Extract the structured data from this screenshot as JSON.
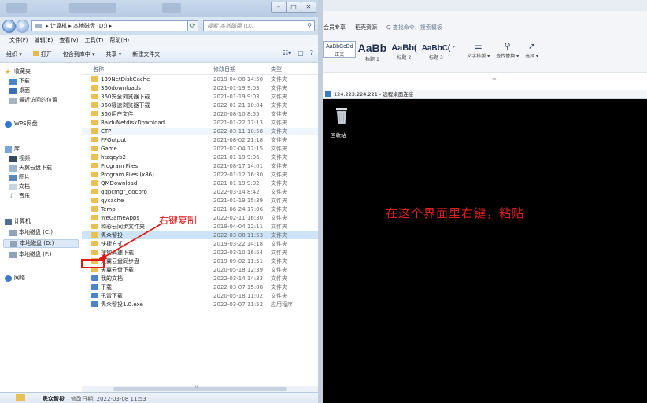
{
  "explorer": {
    "window_buttons": [
      "–",
      "□",
      "✕"
    ],
    "address": {
      "crumbs": [
        "计算机",
        "本地磁盘 (D:)"
      ],
      "separator": "▸",
      "search_placeholder": "搜索 本地磁盘 (D:)"
    },
    "menu": [
      "文件(F)",
      "编辑(E)",
      "查看(V)",
      "工具(T)",
      "帮助(H)"
    ],
    "toolbar": [
      "组织 ▾",
      "打开",
      "包含到库中 ▾",
      "共享 ▾",
      "新建文件夹"
    ],
    "nav": {
      "favorites": "收藏夹",
      "fav_items": [
        "下载",
        "桌面",
        "最近访问的位置"
      ],
      "wps": "WPS网盘",
      "library": "库",
      "lib_items": [
        "视频",
        "天翼云盘下载",
        "图片",
        "文档",
        "音乐"
      ],
      "computer": "计算机",
      "drives": [
        "本地磁盘 (C:)",
        "本地磁盘 (D:)",
        "本地磁盘 (F:)"
      ],
      "network": "网络"
    },
    "columns": [
      "名称",
      "修改日期",
      "类型"
    ],
    "files": [
      {
        "name": "139NetDiskCache",
        "date": "2019-04-08 14:50",
        "type": "文件夹"
      },
      {
        "name": "360downloads",
        "date": "2021-01-19 9:03",
        "type": "文件夹"
      },
      {
        "name": "360安全浏览器下载",
        "date": "2021-01-19 9:03",
        "type": "文件夹"
      },
      {
        "name": "360极速浏览器下载",
        "date": "2022-01-21 10:04",
        "type": "文件夹"
      },
      {
        "name": "360用户文件",
        "date": "2020-08-10 8:55",
        "type": "文件夹"
      },
      {
        "name": "BaiduNetdiskDownload",
        "date": "2021-01-22 17:13",
        "type": "文件夹"
      },
      {
        "name": "CTP",
        "date": "2022-03-11 10:58",
        "type": "文件夹"
      },
      {
        "name": "FFOutput",
        "date": "2021-08-02 21:18",
        "type": "文件夹"
      },
      {
        "name": "Game",
        "date": "2021-07-04 12:15",
        "type": "文件夹"
      },
      {
        "name": "htzqzyb2",
        "date": "2021-01-19 9:06",
        "type": "文件夹"
      },
      {
        "name": "Program Files",
        "date": "2021-08-17 14:01",
        "type": "文件夹"
      },
      {
        "name": "Program Files (x86)",
        "date": "2022-01-12 16:30",
        "type": "文件夹"
      },
      {
        "name": "QMDownload",
        "date": "2021-01-19 9:02",
        "type": "文件夹"
      },
      {
        "name": "qqpcmgr_docpro",
        "date": "2022-03-14 8:42",
        "type": "文件夹"
      },
      {
        "name": "qycache",
        "date": "2021-01-19 15:39",
        "type": "文件夹"
      },
      {
        "name": "Temp",
        "date": "2021-06-24 17:06",
        "type": "文件夹"
      },
      {
        "name": "WeGameApps",
        "date": "2022-02-11 16:30",
        "type": "文件夹"
      },
      {
        "name": "和彩云同步文件夹",
        "date": "2019-04-04 12:11",
        "type": "文件夹"
      },
      {
        "name": "隽众智投",
        "date": "2022-03-08 11:53",
        "type": "文件夹"
      },
      {
        "name": "快捷方式",
        "date": "2019-03-22 14:18",
        "type": "文件夹"
      },
      {
        "name": "搜狗高速下载",
        "date": "2022-03-10 16:54",
        "type": "文件夹"
      },
      {
        "name": "天翼云盘同步盘",
        "date": "2019-09-02 11:51",
        "type": "文件夹"
      },
      {
        "name": "天翼云盘下载",
        "date": "2020-05-18 12:39",
        "type": "文件夹"
      },
      {
        "name": "我的文档",
        "date": "2022-03-14 14:33",
        "type": "文件夹"
      },
      {
        "name": "下载",
        "date": "2022-03-07 15:08",
        "type": "文件夹"
      },
      {
        "name": "迅雷下载",
        "date": "2020-05-18 11:02",
        "type": "文件夹"
      },
      {
        "name": "隽众智投1.0.exe",
        "date": "2022-03-07 11:52",
        "type": "应用程序"
      }
    ],
    "annotation": "右键复制",
    "status": {
      "name": "隽众智投",
      "meta": "修改日期: 2022-03-08 11:53"
    },
    "scroll_marker": "III"
  },
  "wps": {
    "tabs": [
      "会员专享",
      "稻壳资源",
      "Q 查找命令、搜索模板"
    ],
    "styles": [
      {
        "preview": "AaBbCcDd",
        "label": "正文"
      },
      {
        "preview": "AaBb",
        "label": "标题 1"
      },
      {
        "preview": "AaBb(",
        "label": "标题 2"
      },
      {
        "preview": "AaBbC(",
        "label": "标题 3"
      }
    ],
    "tools": [
      "文字排版 ▾",
      "查找替换 ▾",
      "选择 ▾"
    ]
  },
  "rdp": {
    "title": "124.223.224.221 - 远程桌面连接",
    "recycle_label": "回收站",
    "instruction": "在这个界面里右键，粘贴"
  }
}
